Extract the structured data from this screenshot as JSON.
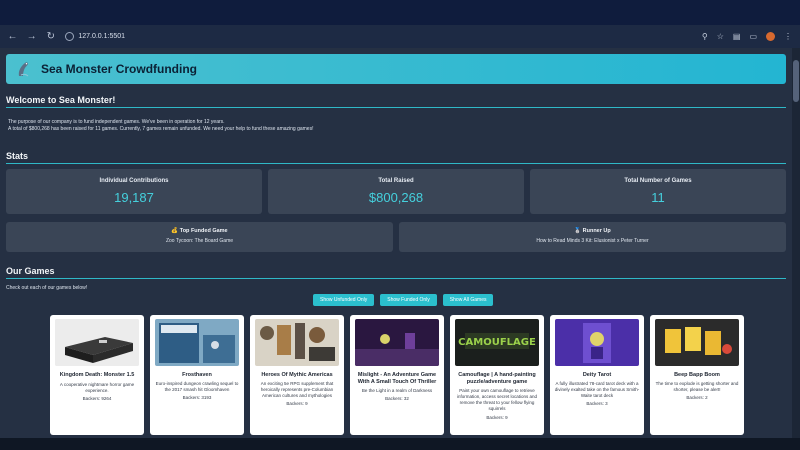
{
  "browser": {
    "url": "127.0.0.1:5501"
  },
  "hero": {
    "title": "Sea Monster Crowdfunding"
  },
  "welcome": {
    "title": "Welcome to Sea Monster!",
    "line1": "The purpose of our company is to fund independent games. We've been in operation for 12 years.",
    "line2": "A total of $800,268 has been raised for 11 games. Currently, 7 games remain unfunded. We need your help to fund these amazing games!"
  },
  "stats": {
    "title": "Stats",
    "items": [
      {
        "label": "Individual Contributions",
        "value": "19,187"
      },
      {
        "label": "Total Raised",
        "value": "$800,268"
      },
      {
        "label": "Total Number of Games",
        "value": "11"
      }
    ],
    "top_funded": {
      "label": "Top Funded Game",
      "value": "Zoo Tycoon: The Board Game"
    },
    "runner_up": {
      "label": "Runner Up",
      "value": "How to Read Minds 3 Kit: Elusionist x Peter Turner"
    }
  },
  "games": {
    "title": "Our Games",
    "intro": "Check out each of our games below!",
    "filters": [
      "Show Unfunded Only",
      "Show Funded Only",
      "Show All Games"
    ],
    "cards": [
      {
        "name": "Kingdom Death: Monster 1.5",
        "description": "A cooperative nightmare horror game experience.",
        "backers": "Backers: 9264"
      },
      {
        "name": "Frosthaven",
        "description": "Euro-inspired dungeon crawling sequel to the 2017 smash hit Gloomhaven",
        "backers": "Backers: 3193"
      },
      {
        "name": "Heroes Of Mythic Americas",
        "description": "An exciting 5e RPG supplement that heroically represents pre-Columbian American cultures and mythologies",
        "backers": "Backers: 9"
      },
      {
        "name": "Mislight - An Adventure Game With A Small Touch Of Thriller",
        "description": "Be the Light in a realm of Darkness",
        "backers": "Backers: 32"
      },
      {
        "name": "Camouflage | A hand-painting puzzle/adventure game",
        "description": "Paint your own camouflage to retrieve information, access secret locations and remove the threat to your fellow flying squirrels",
        "backers": "Backers: 9"
      },
      {
        "name": "Deity Tarot",
        "description": "A fully illustrated 78-card tarot deck with a divinely exalted take on the famous Smith-Waite tarot deck",
        "backers": "Backers: 3"
      },
      {
        "name": "Beep Bapp Boom",
        "description": "The time to explode is getting shorter and shorter, please be alert!",
        "backers": "Backers: 2"
      }
    ]
  }
}
